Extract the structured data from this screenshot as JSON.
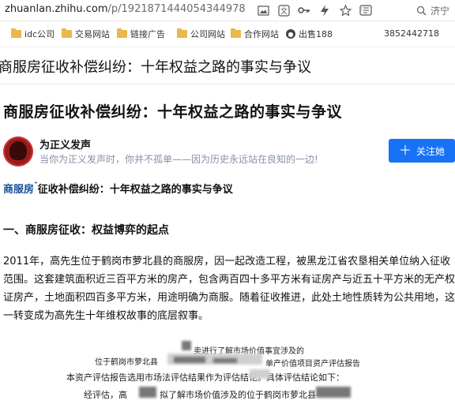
{
  "address_bar": {
    "url_host": "zhuanlan.zhihu.com",
    "url_path": "/p/1921871444054344978",
    "search_label": "济宁"
  },
  "bookmarks": {
    "items": [
      {
        "label": "idc公司",
        "icon": "folder-icon"
      },
      {
        "label": "交易网站",
        "icon": "folder-icon"
      },
      {
        "label": "链接广告",
        "icon": "folder-icon"
      },
      {
        "label": "公司网站",
        "icon": "folder-icon"
      },
      {
        "label": "合作网站",
        "icon": "folder-icon"
      },
      {
        "label": "出售188",
        "icon": "globe-icon"
      }
    ],
    "phone": "3852442718"
  },
  "sticky_header": {
    "title": "商服房征收补偿纠纷：十年权益之路的事实与争议"
  },
  "article": {
    "title": "商服房征收补偿纠纷：十年权益之路的事实与争议",
    "author": {
      "name": "为正义发声",
      "bio": "当你为正义发声时，你并不孤单——因为历史永远站在良知的一边!"
    },
    "follow_label": "关注她",
    "subtitle_keyword": "商服房",
    "subtitle_rest": "征收补偿纠纷：十年权益之路的事实与争议",
    "section_heading": "一、商服房征收：权益博弈的起点",
    "paragraph": "2011年，高先生位于鹤岗市萝北县的商服房，因一起改造工程，被黑龙江省农垦相关单位纳入征收范围。这套建筑面积近三百平方米的房产，包含两百四十多平方米有证房产与近五十平方米的无产权证房产，土地面积四百多平方米，用途明确为商服。随着征收推进，此处土地性质转为公共用地，这一转变成为高先生十年维权故事的底层叙事。",
    "scan": {
      "line1_left": "位于鹤岗市萝北县",
      "line0_right": "卖进行了解市场价值事宜涉及的",
      "line1_right": "单产价值项目资产评估报告",
      "line2": "本资产评估报告选用市场法评估结果作为评估结论。具体评估结论如下：",
      "line3_left": "经评估，高",
      "line3_right": "拟了解市场价值涉及的位于鹤岗市萝北县"
    }
  },
  "colors": {
    "accent": "#1772f6",
    "link": "#175199",
    "muted": "#8590a6"
  }
}
